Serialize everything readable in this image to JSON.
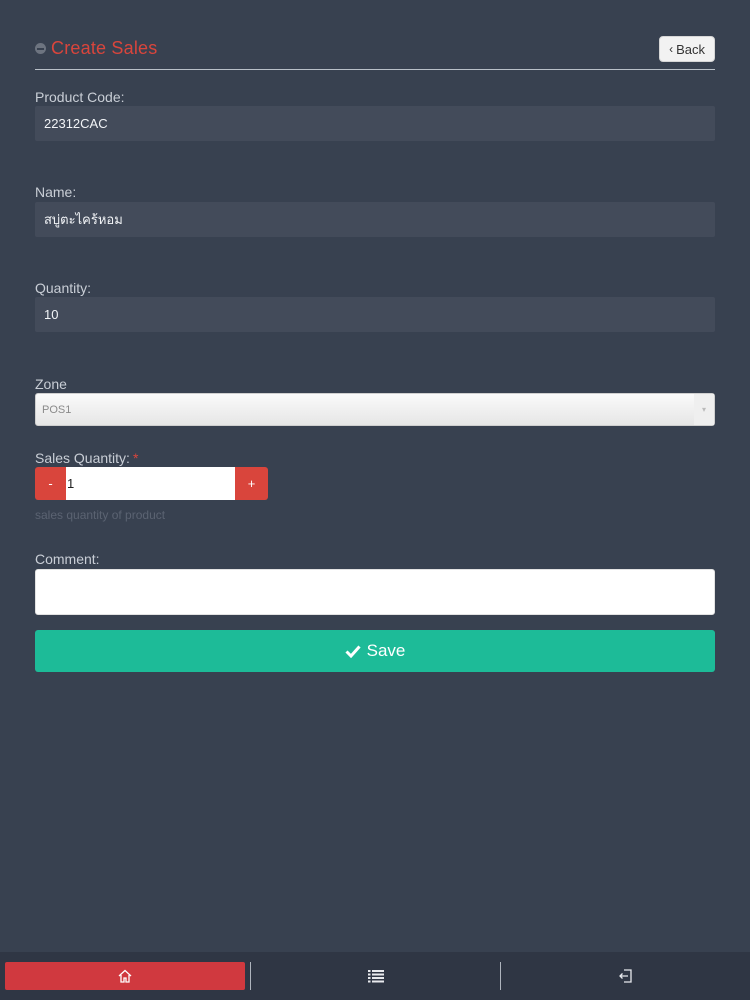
{
  "header": {
    "title": "Create Sales",
    "back_label": "Back"
  },
  "form": {
    "product_code": {
      "label": "Product Code:",
      "value": "22312CAC"
    },
    "name": {
      "label": "Name:",
      "value": "สบู่ตะไคร้หอม"
    },
    "quantity": {
      "label": "Quantity:",
      "value": "10"
    },
    "zone": {
      "label": "Zone",
      "selected": "POS1"
    },
    "sales_quantity": {
      "label": "Sales Quantity:",
      "required_mark": "*",
      "value": "1",
      "minus_label": "-",
      "plus_label": "+",
      "help": "sales quantity of product"
    },
    "comment": {
      "label": "Comment:",
      "value": ""
    },
    "save_label": "Save"
  },
  "footer": {
    "items": [
      {
        "icon": "home-icon"
      },
      {
        "icon": "list-icon"
      },
      {
        "icon": "logout-icon"
      }
    ]
  },
  "colors": {
    "background": "#384150",
    "accent_red": "#d9453c",
    "save_green": "#1dbb98",
    "footer_bg": "#2f3644"
  }
}
